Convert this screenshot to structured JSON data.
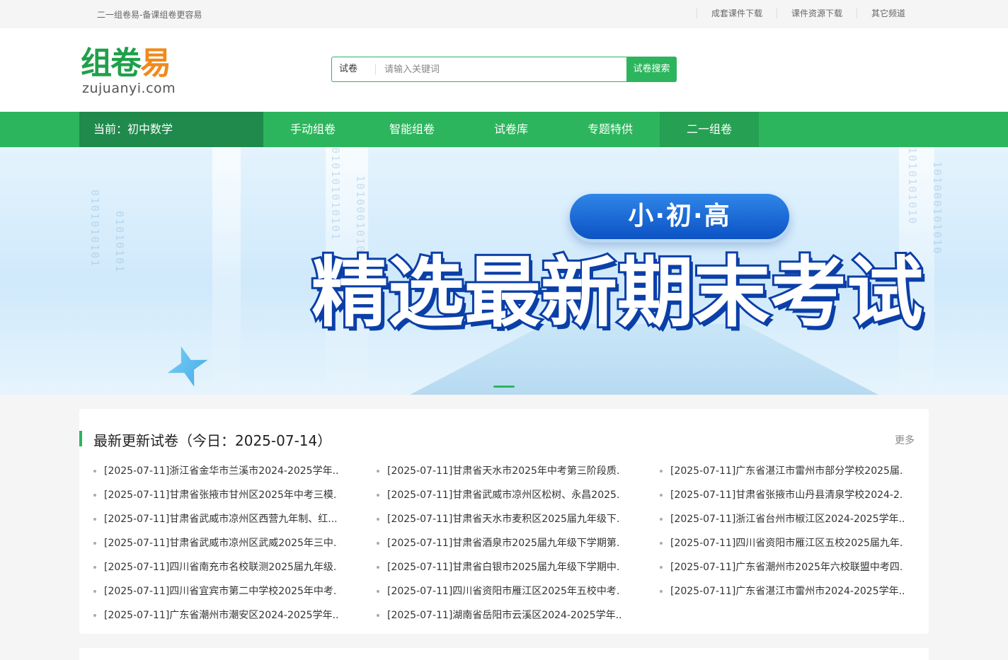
{
  "topbar": {
    "slogan": "二一组卷易-备课组卷更容易",
    "links": [
      "成套课件下载",
      "课件资源下载",
      "其它频道"
    ]
  },
  "logo": {
    "cn_part1": "组卷",
    "cn_part2": "易",
    "en": "zujuanyi.com"
  },
  "search": {
    "type": "试卷",
    "placeholder": "请输入关键词",
    "button": "试卷搜索"
  },
  "nav": {
    "current": "当前：初中数学",
    "items": [
      "手动组卷",
      "智能组卷",
      "试卷库",
      "专题特供",
      "二一组卷"
    ]
  },
  "banner": {
    "pill": "小·初·高",
    "headline": "精选最新期末考试"
  },
  "latest": {
    "title": "最新更新试卷（今日：2025-07-14）",
    "more": "更多",
    "rows": [
      [
        "[2025-07-11]浙江省金华市兰溪市2024-2025学年...",
        "[2025-07-11]甘肃省天水市2025年中考第三阶段质...",
        "[2025-07-11]广东省湛江市雷州市部分学校2025届..."
      ],
      [
        "[2025-07-11]甘肃省张掖市甘州区2025年中考三模...",
        "[2025-07-11]甘肃省武威市凉州区松树、永昌2025...",
        "[2025-07-11]甘肃省张掖市山丹县清泉学校2024-2..."
      ],
      [
        "[2025-07-11]甘肃省武威市凉州区西营九年制、红...",
        "[2025-07-11]甘肃省天水市麦积区2025届九年级下...",
        "[2025-07-11]浙江省台州市椒江区2024-2025学年..."
      ],
      [
        "[2025-07-11]甘肃省武威市凉州区武威2025年三中...",
        "[2025-07-11]甘肃省酒泉市2025届九年级下学期第...",
        "[2025-07-11]四川省资阳市雁江区五校2025届九年..."
      ],
      [
        "[2025-07-11]四川省南充市名校联测2025届九年级...",
        "[2025-07-11]甘肃省白银市2025届九年级下学期中...",
        "[2025-07-11]广东省潮州市2025年六校联盟中考四..."
      ],
      [
        "[2025-07-11]四川省宜宾市第二中学校2025年中考...",
        "[2025-07-11]四川省资阳市雁江区2025年五校中考...",
        "[2025-07-11]广东省湛江市雷州市2024-2025学年..."
      ],
      [
        "[2025-07-11]广东省潮州市潮安区2024-2025学年...",
        "[2025-07-11]湖南省岳阳市云溪区2024-2025学年...",
        ""
      ]
    ]
  },
  "colors": {
    "brand_green": "#2db55d",
    "nav_dark": "#1f8a4c",
    "banner_blue": "#0b3fa8",
    "logo_orange": "#f08a1c"
  }
}
